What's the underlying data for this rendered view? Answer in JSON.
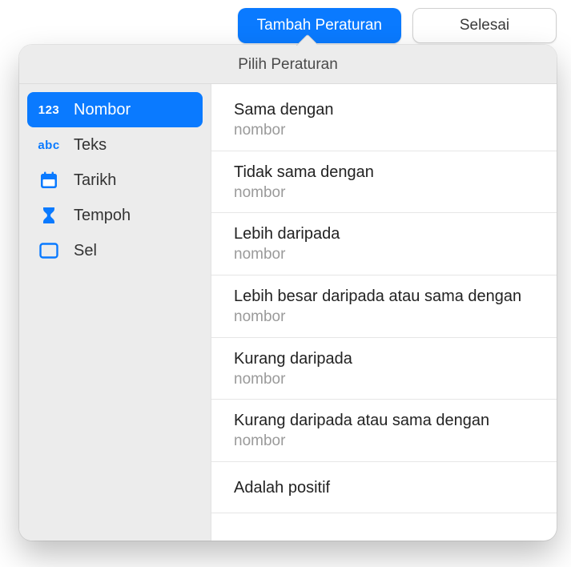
{
  "toolbar": {
    "add_rule_label": "Tambah Peraturan",
    "done_label": "Selesai"
  },
  "popover": {
    "title": "Pilih Peraturan"
  },
  "sidebar": {
    "items": [
      {
        "icon_text": "123",
        "label": "Nombor",
        "selected": true
      },
      {
        "icon_text": "abc",
        "label": "Teks"
      },
      {
        "label": "Tarikh"
      },
      {
        "label": "Tempoh"
      },
      {
        "label": "Sel"
      }
    ]
  },
  "rules": [
    {
      "title": "Sama dengan",
      "sub": "nombor"
    },
    {
      "title": "Tidak sama dengan",
      "sub": "nombor"
    },
    {
      "title": "Lebih daripada",
      "sub": "nombor"
    },
    {
      "title": "Lebih besar daripada atau sama dengan",
      "sub": "nombor"
    },
    {
      "title": "Kurang daripada",
      "sub": "nombor"
    },
    {
      "title": "Kurang daripada atau sama dengan",
      "sub": "nombor"
    },
    {
      "title": "Adalah positif"
    }
  ]
}
